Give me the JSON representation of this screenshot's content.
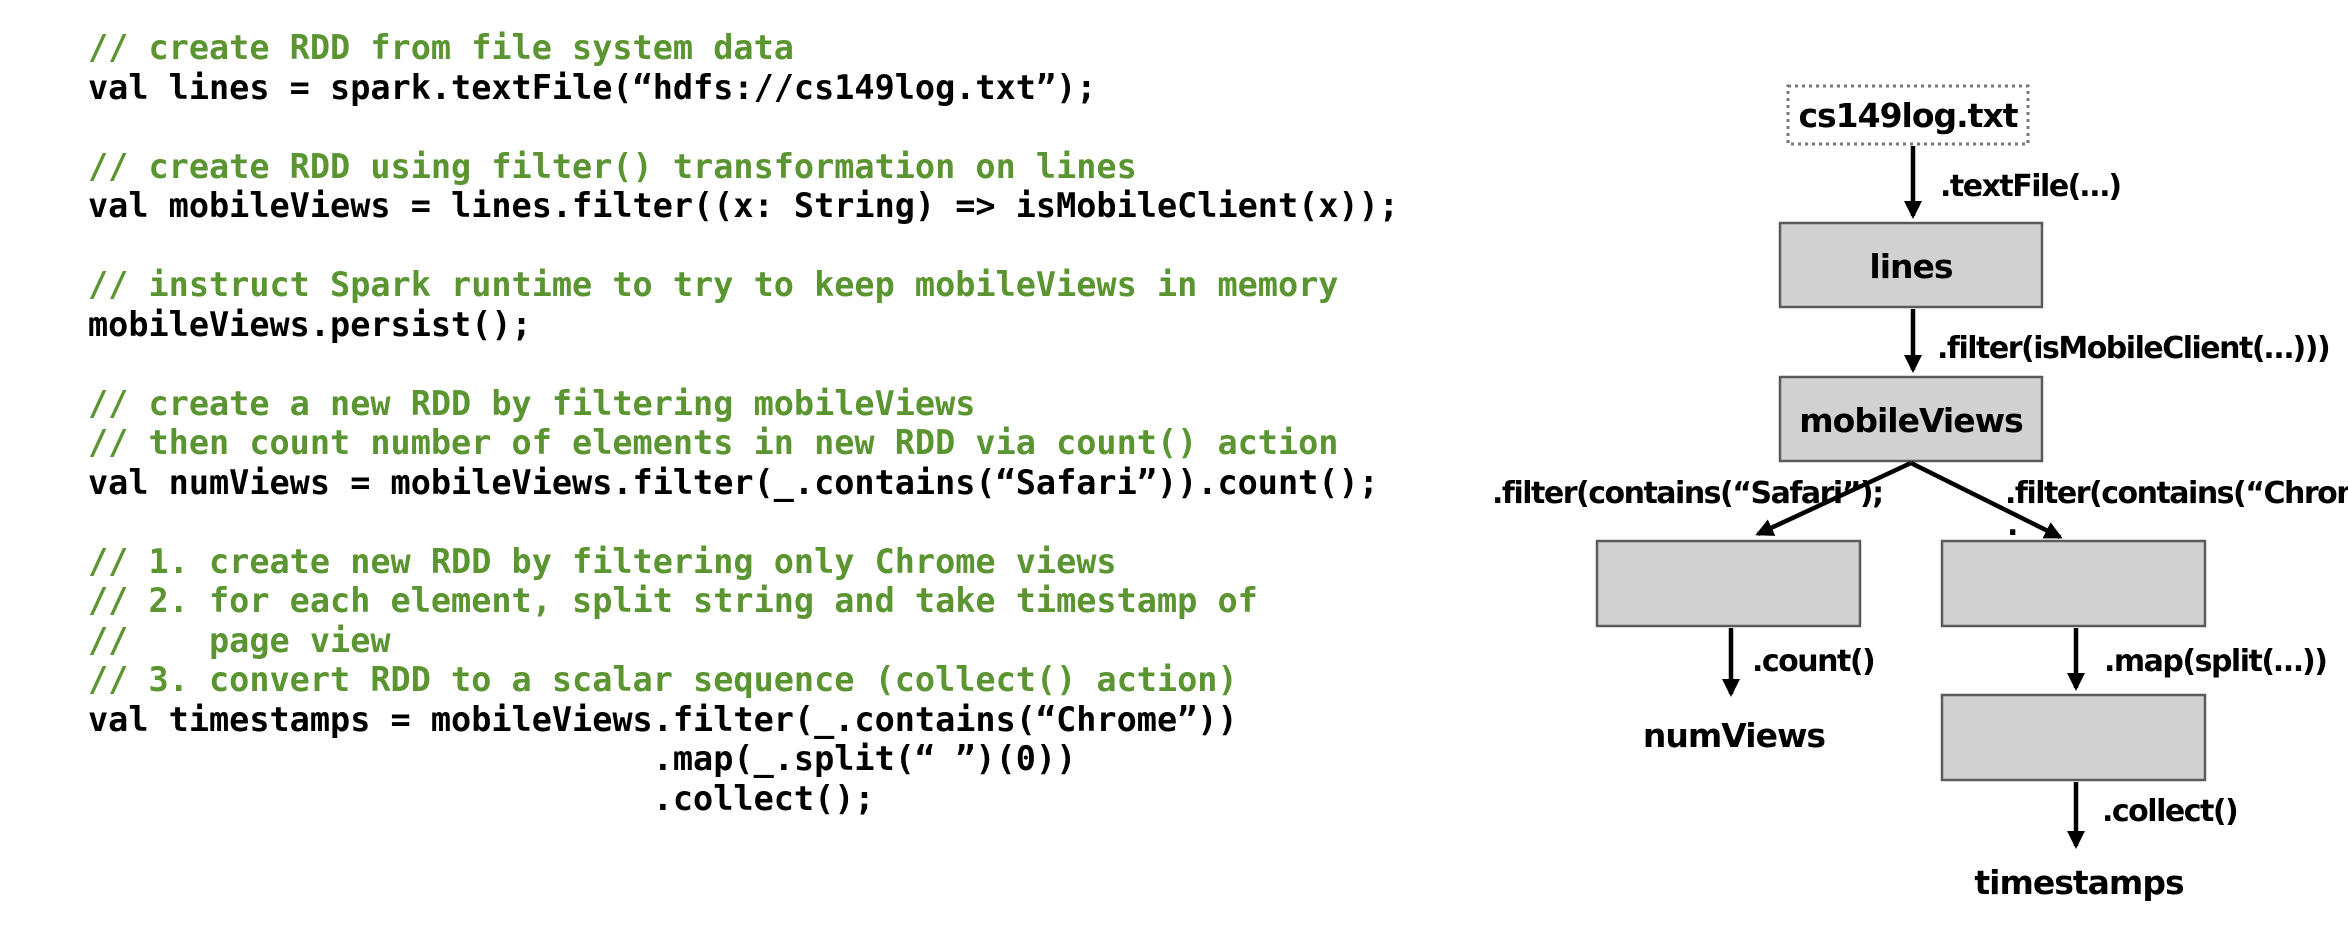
{
  "code_lines": [
    {
      "kind": "comment",
      "text": "// create RDD from file system data"
    },
    {
      "kind": "code",
      "text": "val lines = spark.textFile(“hdfs://cs149log.txt”);"
    },
    {
      "kind": "blank",
      "text": ""
    },
    {
      "kind": "comment",
      "text": "// create RDD using filter() transformation on lines"
    },
    {
      "kind": "code",
      "text": "val mobileViews = lines.filter((x: String) => isMobileClient(x));"
    },
    {
      "kind": "blank",
      "text": ""
    },
    {
      "kind": "comment",
      "text": "// instruct Spark runtime to try to keep mobileViews in memory"
    },
    {
      "kind": "code",
      "text": "mobileViews.persist();"
    },
    {
      "kind": "blank",
      "text": ""
    },
    {
      "kind": "comment",
      "text": "// create a new RDD by filtering mobileViews"
    },
    {
      "kind": "comment",
      "text": "// then count number of elements in new RDD via count() action"
    },
    {
      "kind": "code",
      "text": "val numViews = mobileViews.filter(_.contains(“Safari”)).count();"
    },
    {
      "kind": "blank",
      "text": ""
    },
    {
      "kind": "comment",
      "text": "// 1. create new RDD by filtering only Chrome views"
    },
    {
      "kind": "comment",
      "text": "// 2. for each element, split string and take timestamp of"
    },
    {
      "kind": "comment",
      "text": "//    page view"
    },
    {
      "kind": "comment",
      "text": "// 3. convert RDD to a scalar sequence (collect() action)"
    },
    {
      "kind": "code",
      "text": "val timestamps = mobileViews.filter(_.contains(“Chrome”))"
    },
    {
      "kind": "code",
      "text": "                            .map(_.split(“ ”)(0))"
    },
    {
      "kind": "code",
      "text": "                            .collect();"
    }
  ],
  "diagram": {
    "nodes": {
      "source": "cs149log.txt",
      "lines": "lines",
      "mobile_views": "mobileViews",
      "safari": "",
      "chrome": "",
      "mapped": ""
    },
    "edges": {
      "text_file": ".textFile(…)",
      "filter_mobile": ".filter(isMobileClient(…)))",
      "filter_safari": ".filter(contains(“Safari”);",
      "filter_chrome": ".filter(contains(“Chrome”)",
      "filter_chrome_tail": ".",
      "count": ".count()",
      "map_split": ".map(split(…))",
      "collect": ".collect()"
    },
    "outputs": {
      "num_views": "numViews",
      "timestamps": "timestamps"
    }
  },
  "colors": {
    "comment": "#5b9532",
    "box_fill": "#d1d1d1",
    "box_stroke": "#5b5b5b"
  }
}
